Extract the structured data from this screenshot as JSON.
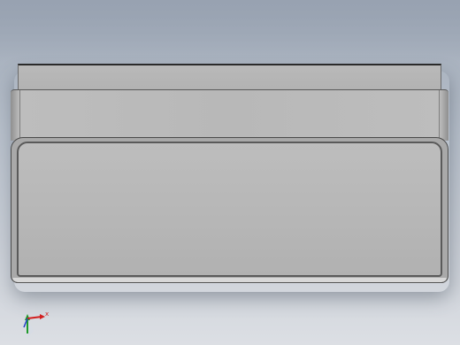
{
  "viewport": {
    "background_top": "#9ea8b6",
    "background_bottom": "#dcdfe4",
    "part_color": "#b8b8b8",
    "edge_color": "#4a4a4a"
  },
  "triad": {
    "x_label": "x",
    "x_color": "#d21f1f",
    "y_color": "#1f9a2a",
    "z_color": "#2340c8"
  }
}
